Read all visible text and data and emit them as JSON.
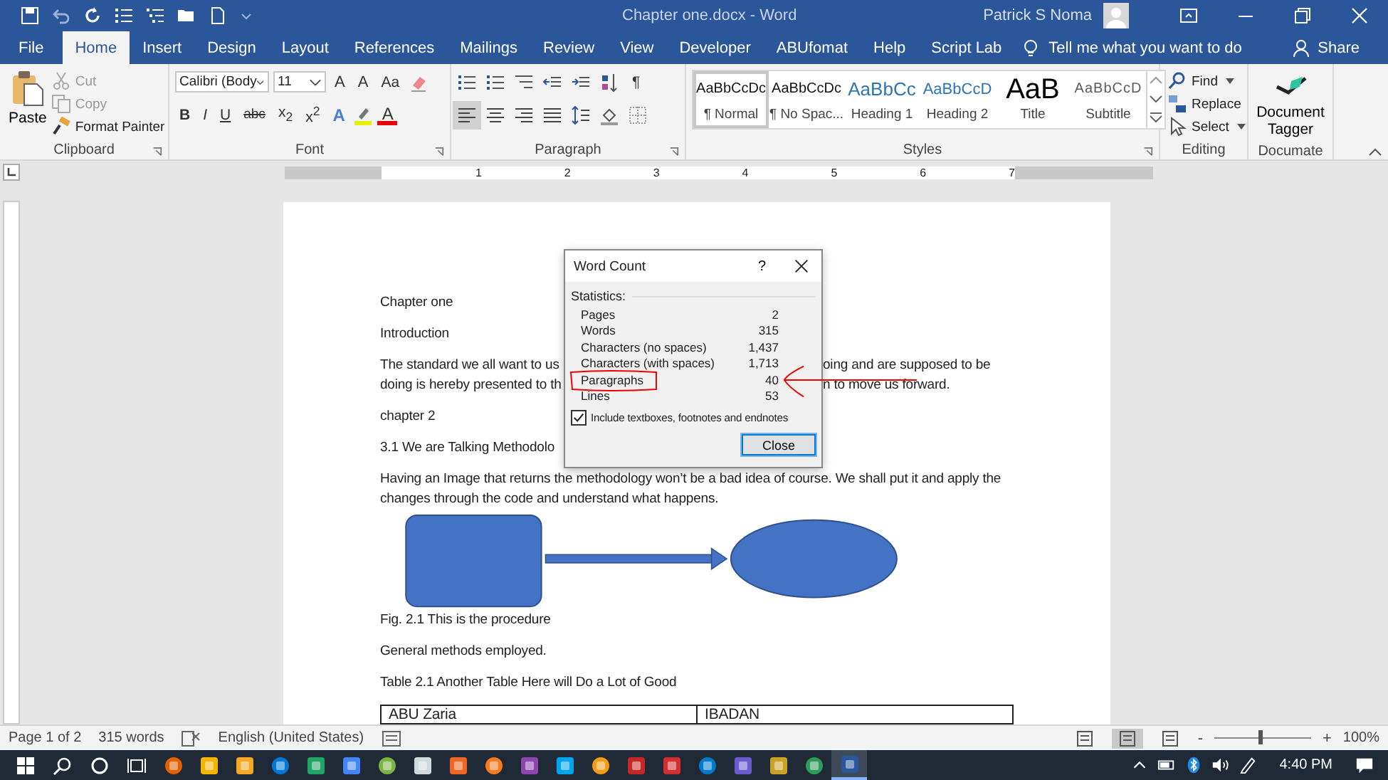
{
  "title_bar": {
    "document_title": "Chapter one.docx  -  Word",
    "user": "Patrick S Noma"
  },
  "tabs": [
    {
      "label": "File",
      "selected": false
    },
    {
      "label": "Home",
      "selected": true
    },
    {
      "label": "Insert",
      "selected": false
    },
    {
      "label": "Design",
      "selected": false
    },
    {
      "label": "Layout",
      "selected": false
    },
    {
      "label": "References",
      "selected": false
    },
    {
      "label": "Mailings",
      "selected": false
    },
    {
      "label": "Review",
      "selected": false
    },
    {
      "label": "View",
      "selected": false
    },
    {
      "label": "Developer",
      "selected": false
    },
    {
      "label": "ABUfomat",
      "selected": false
    },
    {
      "label": "Help",
      "selected": false
    },
    {
      "label": "Script Lab",
      "selected": false
    }
  ],
  "tell_me": "Tell me what you want to do",
  "share": "Share",
  "ribbon": {
    "clipboard": {
      "paste": "Paste",
      "cut": "Cut",
      "copy": "Copy",
      "format_painter": "Format Painter",
      "label": "Clipboard"
    },
    "font": {
      "font_name": "Calibri (Body",
      "font_size": "11",
      "row1_buttons": [
        "A",
        "A",
        "Aa"
      ],
      "row2_buttons": [
        "B",
        "I",
        "U",
        "abc",
        "x$_{2}$",
        "x$^{2}$"
      ],
      "effects": "A",
      "font_color": "A",
      "label": "Font"
    },
    "paragraph": {
      "pilcrow": "¶",
      "label": "Paragraph"
    },
    "styles": {
      "items": [
        {
          "sample": "AaBbCcDc",
          "name": "¶ Normal",
          "kind": "normal",
          "selected": true
        },
        {
          "sample": "AaBbCcDc",
          "name": "¶ No Spac...",
          "kind": "normal",
          "selected": false
        },
        {
          "sample": "AaBbCc",
          "name": "Heading 1",
          "kind": "heading1",
          "selected": false
        },
        {
          "sample": "AaBbCcD",
          "name": "Heading 2",
          "kind": "heading2",
          "selected": false
        },
        {
          "sample": "AaB",
          "name": "Title",
          "kind": "title",
          "selected": false
        },
        {
          "sample": "AaBbCcD",
          "name": "Subtitle",
          "kind": "subtitle",
          "selected": false
        }
      ],
      "label": "Styles"
    },
    "editing": {
      "find": "Find",
      "replace": "Replace",
      "select": "Select",
      "label": "Editing"
    },
    "documate": {
      "button": "Document Tagger",
      "label": "Documate"
    }
  },
  "ruler": {
    "marks": [
      "1",
      "2",
      "3",
      "4",
      "5",
      "6",
      "7"
    ]
  },
  "document": [
    {
      "kind": "line",
      "text": "Chapter one"
    },
    {
      "kind": "line",
      "text": "Introduction"
    },
    {
      "kind": "split",
      "left": "The standard we all want to us",
      "right": "oing and are supposed to be"
    },
    {
      "kind": "split",
      "left": "doing is hereby presented to th",
      "right": "n to move us forward."
    },
    {
      "kind": "line",
      "text": "chapter 2"
    },
    {
      "kind": "line",
      "text": "3.1 We are Talking Methodolo"
    },
    {
      "kind": "line",
      "text": "Having an Image that returns the methodology won’t be a bad idea of course. We shall put it and apply the changes through the code and understand what happens."
    },
    {
      "kind": "figure"
    },
    {
      "kind": "line",
      "text": "Fig. 2.1 This is the procedure"
    },
    {
      "kind": "line",
      "text": "General methods employed."
    },
    {
      "kind": "line",
      "text": "Table 2.1 Another Table Here will Do a Lot of Good"
    },
    {
      "kind": "table",
      "rows": [
        [
          "ABU Zaria",
          "IBADAN"
        ]
      ]
    }
  ],
  "dialog": {
    "title": "Word Count",
    "help": "?",
    "section": "Statistics:",
    "stats": [
      {
        "label": "Pages",
        "value": "2"
      },
      {
        "label": "Words",
        "value": "315"
      },
      {
        "label": "Characters (no spaces)",
        "value": "1,437"
      },
      {
        "label": "Characters (with spaces)",
        "value": "1,713"
      },
      {
        "label": "Paragraphs",
        "value": "40"
      },
      {
        "label": "Lines",
        "value": "53"
      }
    ],
    "include": {
      "label": "Include textboxes, footnotes and endnotes",
      "checked": true
    },
    "close": "Close"
  },
  "status_bar": {
    "page": "Page 1 of 2",
    "words": "315 words",
    "language": "English (United States)",
    "zoom_out": "-",
    "zoom_in": "+",
    "zoom": "100%",
    "zoom_slider": {
      "level": 0.47
    },
    "views": [
      {
        "selected": false
      },
      {
        "selected": true
      },
      {
        "selected": false
      }
    ]
  },
  "taskbar": {
    "apps": [
      {
        "selected": false
      },
      {
        "selected": false
      },
      {
        "selected": false
      },
      {
        "selected": false
      },
      {
        "selected": false
      },
      {
        "selected": false
      },
      {
        "selected": false
      },
      {
        "selected": false
      },
      {
        "selected": false
      },
      {
        "selected": false
      },
      {
        "selected": false
      },
      {
        "selected": false
      },
      {
        "selected": false
      },
      {
        "selected": false
      },
      {
        "selected": false
      },
      {
        "selected": false
      },
      {
        "selected": false
      },
      {
        "selected": false
      },
      {
        "selected": false
      },
      {
        "selected": true
      }
    ],
    "time": "4:40 PM"
  }
}
